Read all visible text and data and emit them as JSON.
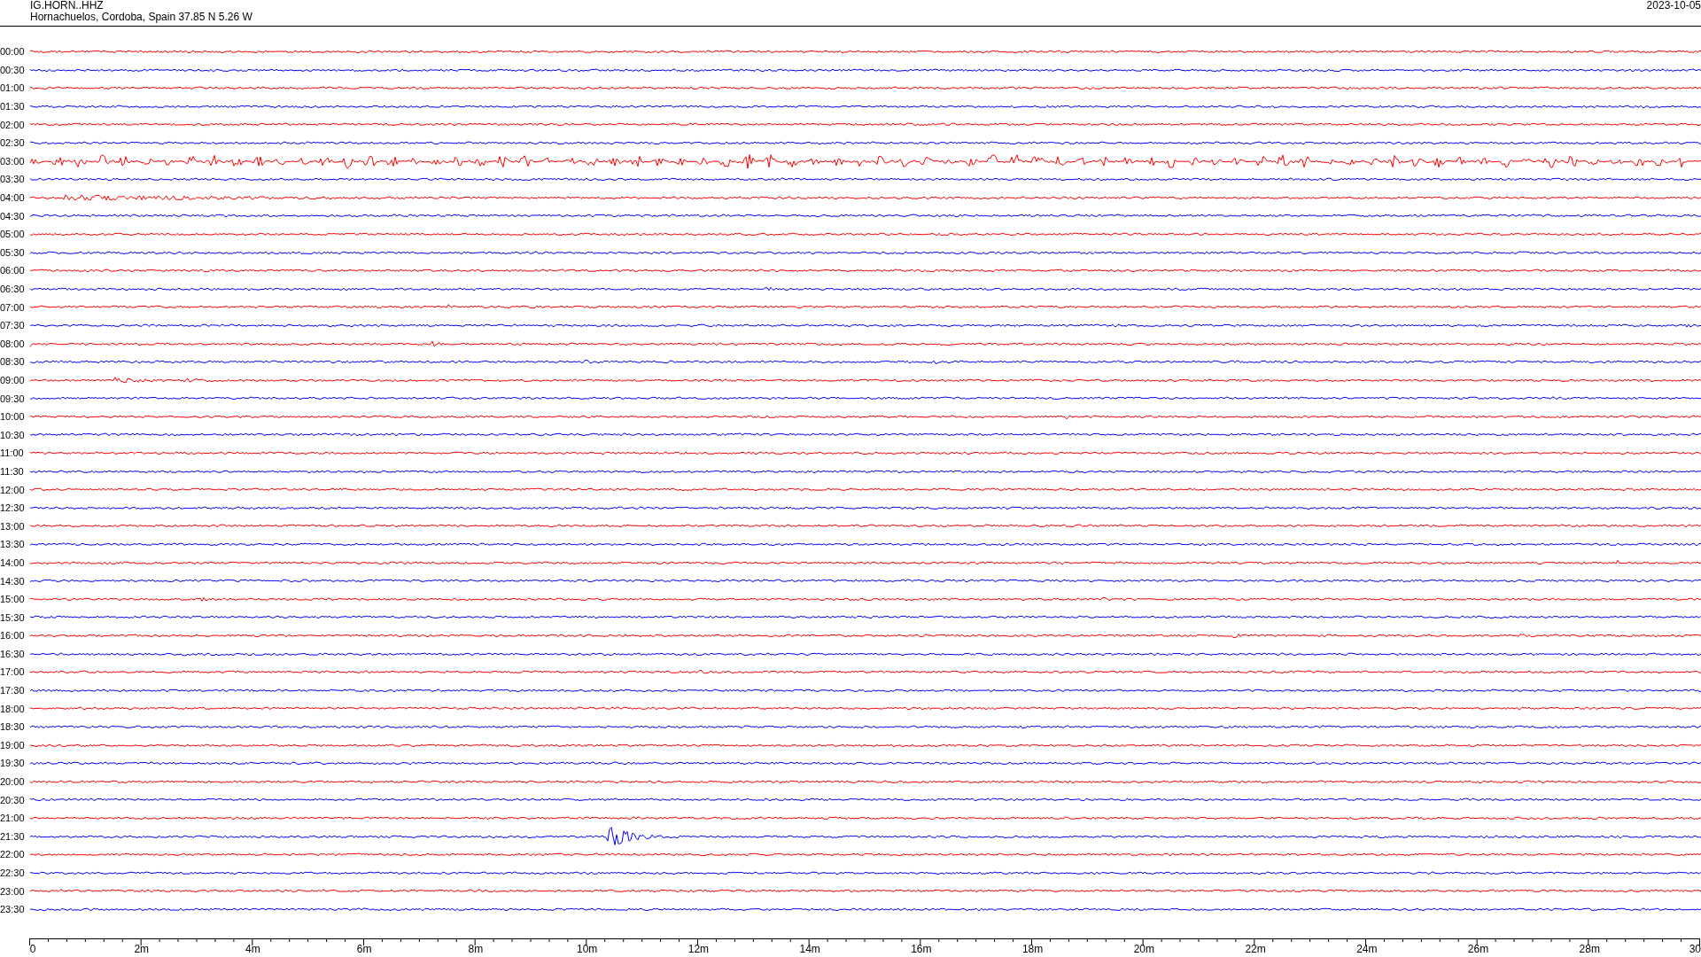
{
  "header": {
    "station": "IG.HORN..HHZ",
    "location": "Hornachuelos, Cordoba, Spain  37.85 N 5.26 W",
    "date": "2023-10-05"
  },
  "rows": [
    {
      "time": "00:00",
      "color": "#ff0000"
    },
    {
      "time": "00:30",
      "color": "#0000ff"
    },
    {
      "time": "01:00",
      "color": "#ff0000"
    },
    {
      "time": "01:30",
      "color": "#0000ff"
    },
    {
      "time": "02:00",
      "color": "#ff0000"
    },
    {
      "time": "02:30",
      "color": "#0000ff"
    },
    {
      "time": "03:00",
      "color": "#ff0000"
    },
    {
      "time": "03:30",
      "color": "#0000ff"
    },
    {
      "time": "04:00",
      "color": "#ff0000"
    },
    {
      "time": "04:30",
      "color": "#0000ff"
    },
    {
      "time": "05:00",
      "color": "#ff0000"
    },
    {
      "time": "05:30",
      "color": "#0000ff"
    },
    {
      "time": "06:00",
      "color": "#ff0000"
    },
    {
      "time": "06:30",
      "color": "#0000ff"
    },
    {
      "time": "07:00",
      "color": "#ff0000"
    },
    {
      "time": "07:30",
      "color": "#0000ff"
    },
    {
      "time": "08:00",
      "color": "#ff0000"
    },
    {
      "time": "08:30",
      "color": "#0000ff"
    },
    {
      "time": "09:00",
      "color": "#ff0000"
    },
    {
      "time": "09:30",
      "color": "#0000ff"
    },
    {
      "time": "10:00",
      "color": "#ff0000"
    },
    {
      "time": "10:30",
      "color": "#0000ff"
    },
    {
      "time": "11:00",
      "color": "#ff0000"
    },
    {
      "time": "11:30",
      "color": "#0000ff"
    },
    {
      "time": "12:00",
      "color": "#ff0000"
    },
    {
      "time": "12:30",
      "color": "#0000ff"
    },
    {
      "time": "13:00",
      "color": "#ff0000"
    },
    {
      "time": "13:30",
      "color": "#0000ff"
    },
    {
      "time": "14:00",
      "color": "#ff0000"
    },
    {
      "time": "14:30",
      "color": "#0000ff"
    },
    {
      "time": "15:00",
      "color": "#ff0000"
    },
    {
      "time": "15:30",
      "color": "#0000ff"
    },
    {
      "time": "16:00",
      "color": "#ff0000"
    },
    {
      "time": "16:30",
      "color": "#0000ff"
    },
    {
      "time": "17:00",
      "color": "#ff0000"
    },
    {
      "time": "17:30",
      "color": "#0000ff"
    },
    {
      "time": "18:00",
      "color": "#ff0000"
    },
    {
      "time": "18:30",
      "color": "#0000ff"
    },
    {
      "time": "19:00",
      "color": "#ff0000"
    },
    {
      "time": "19:30",
      "color": "#0000ff"
    },
    {
      "time": "20:00",
      "color": "#ff0000"
    },
    {
      "time": "20:30",
      "color": "#0000ff"
    },
    {
      "time": "21:00",
      "color": "#ff0000"
    },
    {
      "time": "21:30",
      "color": "#0000ff"
    },
    {
      "time": "22:00",
      "color": "#ff0000"
    },
    {
      "time": "22:30",
      "color": "#0000ff"
    },
    {
      "time": "23:00",
      "color": "#ff0000"
    },
    {
      "time": "23:30",
      "color": "#0000ff"
    }
  ],
  "axis": {
    "labels": [
      "0",
      "2m",
      "4m",
      "6m",
      "8m",
      "10m",
      "12m",
      "14m",
      "16m",
      "18m",
      "20m",
      "22m",
      "24m",
      "26m",
      "28m",
      "30"
    ]
  }
}
